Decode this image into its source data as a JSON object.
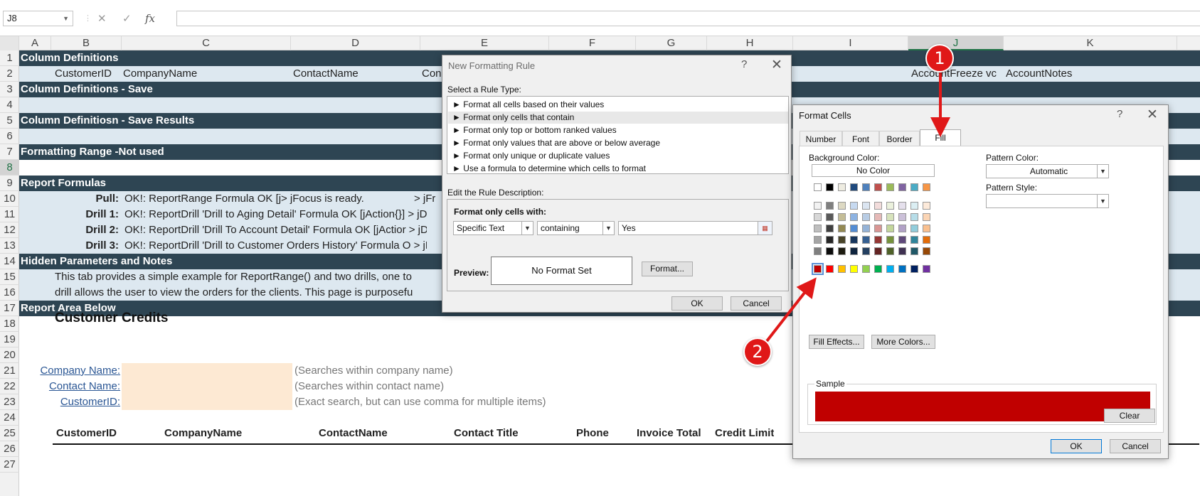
{
  "formula_bar": {
    "name_box": "J8",
    "cancel": "✕",
    "enter": "✓",
    "fx": "fx",
    "formula": ""
  },
  "columns": [
    "A",
    "B",
    "C",
    "D",
    "E",
    "F",
    "G",
    "H",
    "I",
    "J",
    "K"
  ],
  "rows": [
    "1",
    "2",
    "3",
    "4",
    "5",
    "6",
    "7",
    "8",
    "9",
    "10",
    "11",
    "12",
    "13",
    "14",
    "15",
    "16",
    "17",
    "18",
    "19",
    "20",
    "21",
    "22",
    "23",
    "24",
    "25",
    "26",
    "27"
  ],
  "sheet": {
    "r1": "Column Definitions",
    "r2": {
      "b": "CustomerID",
      "c": "CompanyName",
      "d": "ContactName",
      "e": "Con",
      "j": "AccountFreeze vc",
      "k": "AccountNotes"
    },
    "r3": "Column Definitions - Save",
    "r5": "Column Definitiosn - Save Results",
    "r7": "Formatting Range -Not used",
    "r9": "Report Formulas",
    "r10": {
      "label": "Pull:",
      "value": "OK!: ReportRange Formula OK [j/",
      "tail": "> jFocus is ready.",
      "tail2": "> jFr"
    },
    "r11": {
      "label": "Drill 1:",
      "value": "OK!: ReportDrill 'Drill to Aging Detail' Formula OK [jAction{}] > jD"
    },
    "r12": {
      "label": "Drill 2:",
      "value": "OK!: ReportDrill 'Drill To Account Detail' Formula OK [jActior > jD"
    },
    "r13": {
      "label": "Drill 3:",
      "value": "OK!: ReportDrill 'Drill to Customer Orders History' Formula O > jD"
    },
    "r14": "Hidden Parameters and Notes",
    "r15": "This tab provides a simple example for ReportRange() and two drills, one to",
    "r16": "drill allows the user to view the orders for the clients.   This page is purposefu",
    "r17": "Report Area Below",
    "r19": "Customer Credits",
    "r21": {
      "label": "Company Name:",
      "hint": "(Searches within company name)"
    },
    "r22": {
      "label": "Contact Name:",
      "hint": "(Searches within contact name)"
    },
    "r23": {
      "label": "CustomerID:",
      "hint": "(Exact search, but can use comma for multiple items)"
    },
    "r25": [
      "CustomerID",
      "CompanyName",
      "ContactName",
      "Contact Title",
      "Phone",
      "Invoice Total",
      "Credit Limit"
    ]
  },
  "new_rule_dialog": {
    "title": "New Formatting Rule",
    "help": "?",
    "close": "✕",
    "select_label": "Select a Rule Type:",
    "rule_types": [
      "► Format all cells based on their values",
      "► Format only cells that contain",
      "► Format only top or bottom ranked values",
      "► Format only values that are above or below average",
      "► Format only unique or duplicate values",
      "► Use a formula to determine which cells to format"
    ],
    "edit_label": "Edit the Rule Description:",
    "format_only_label": "Format only cells with:",
    "combo1": "Specific Text",
    "combo2": "containing",
    "value": "Yes",
    "preview_label": "Preview:",
    "preview_text": "No Format Set",
    "format_btn": "Format...",
    "ok": "OK",
    "cancel": "Cancel"
  },
  "format_cells_dialog": {
    "title": "Format Cells",
    "help": "?",
    "close": "✕",
    "tabs": [
      "Number",
      "Font",
      "Border",
      "Fill"
    ],
    "bg_label": "Background Color:",
    "no_color": "No Color",
    "pattern_color_label": "Pattern Color:",
    "pattern_color": "Automatic",
    "pattern_style_label": "Pattern Style:",
    "pattern_style": "",
    "fill_effects": "Fill Effects...",
    "more_colors": "More Colors...",
    "sample_label": "Sample",
    "sample_color": "#c00000",
    "clear": "Clear",
    "ok": "OK",
    "cancel": "Cancel",
    "theme_top": [
      "#ffffff",
      "#000000",
      "#eeece1",
      "#1f497d",
      "#4f81bd",
      "#c0504d",
      "#9bbb59",
      "#8064a2",
      "#4bacc6",
      "#f79646"
    ],
    "theme_shades": [
      [
        "#f2f2f2",
        "#7f7f7f",
        "#ddd9c3",
        "#c6d9f0",
        "#dbe5f1",
        "#f2dcdb",
        "#ebf1dd",
        "#e5e0ec",
        "#dbeef3",
        "#fdeada"
      ],
      [
        "#d8d8d8",
        "#595959",
        "#c4bd97",
        "#8db3e2",
        "#b8cce4",
        "#e5b9b7",
        "#d7e3bc",
        "#ccc1d9",
        "#b7dde8",
        "#fbd5b5"
      ],
      [
        "#bfbfbf",
        "#3f3f3f",
        "#938953",
        "#548dd4",
        "#95b3d7",
        "#d99694",
        "#c3d69b",
        "#b2a2c7",
        "#92cddc",
        "#fac08f"
      ],
      [
        "#a5a5a5",
        "#262626",
        "#494429",
        "#17365d",
        "#366092",
        "#953734",
        "#76923c",
        "#5f497a",
        "#31859b",
        "#e36c09"
      ],
      [
        "#7f7f7f",
        "#0c0c0c",
        "#1d1b10",
        "#0f243e",
        "#244061",
        "#632423",
        "#4f6128",
        "#3f3151",
        "#205867",
        "#974806"
      ]
    ],
    "standard": [
      "#c00000",
      "#ff0000",
      "#ffc000",
      "#ffff00",
      "#92d050",
      "#00b050",
      "#00b0f0",
      "#0070c0",
      "#002060",
      "#7030a0"
    ]
  },
  "annotations": {
    "one": "1",
    "two": "2",
    "accent": "#e01818"
  }
}
